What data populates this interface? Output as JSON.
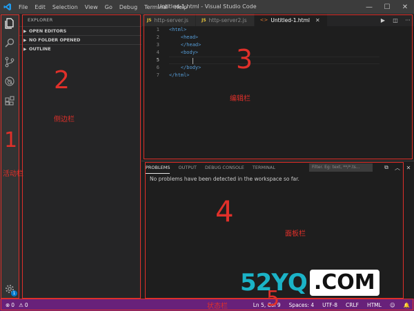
{
  "titlebar": {
    "menu": [
      "File",
      "Edit",
      "Selection",
      "View",
      "Go",
      "Debug",
      "Terminal",
      "Help"
    ],
    "window_title": "Untitled-1.html - Visual Studio Code",
    "controls": {
      "minimize": "—",
      "maximize": "☐",
      "close": "✕"
    }
  },
  "activitybar": {
    "icons": [
      "files-icon",
      "search-icon",
      "source-control-icon",
      "debug-icon",
      "extensions-icon"
    ],
    "settings_badge": "1"
  },
  "sidebar": {
    "title": "EXPLORER",
    "sections": [
      "OPEN EDITORS",
      "NO FOLDER OPENED",
      "OUTLINE"
    ]
  },
  "editor": {
    "tabs": [
      {
        "label": "http-server.js",
        "type": "js",
        "active": false
      },
      {
        "label": "http-server2.js",
        "type": "js",
        "active": false
      },
      {
        "label": "Untitled-1.html",
        "type": "html",
        "active": true
      }
    ],
    "line_numbers": [
      "1",
      "2",
      "3",
      "4",
      "5",
      "6",
      "7"
    ],
    "lines": [
      "<html>",
      "    <head>",
      "    </head>",
      "    <body>",
      "",
      "    </body>",
      "</html>"
    ],
    "current_line": 5
  },
  "panel": {
    "tabs": [
      "PROBLEMS",
      "OUTPUT",
      "DEBUG CONSOLE",
      "TERMINAL"
    ],
    "filter_placeholder": "Filter. Eg: text, **/*.ts...",
    "message": "No problems have been detected in the workspace so far."
  },
  "statusbar": {
    "errors": "0",
    "warnings": "0",
    "items": [
      "Ln 5, Col 9",
      "Spaces: 4",
      "UTF-8",
      "CRLF",
      "HTML",
      "☺",
      "🔔"
    ]
  },
  "annotations": {
    "numbers": [
      "1",
      "2",
      "3",
      "4",
      "5"
    ],
    "labels": {
      "activity": "活动栏",
      "sidebar": "侧边栏",
      "editor": "编辑栏",
      "panel": "面板栏",
      "status": "状态栏"
    }
  },
  "watermark": {
    "part1": "52YQ",
    "part2": ".COM"
  },
  "colors": {
    "statusbar": "#68217a",
    "annotation": "#e0302a",
    "accent": "#007acc"
  }
}
